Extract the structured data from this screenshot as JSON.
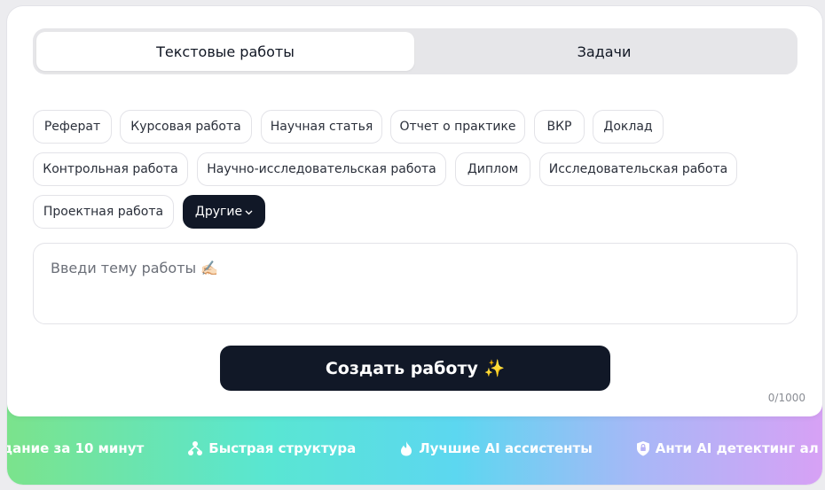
{
  "tabs": [
    {
      "label": "Текстовые работы",
      "active": true
    },
    {
      "label": "Задачи",
      "active": false
    }
  ],
  "chips": [
    {
      "label": "Реферат"
    },
    {
      "label": "Курсовая работа"
    },
    {
      "label": "Научная статья"
    },
    {
      "label": "Отчет о практике"
    },
    {
      "label": "ВКР"
    },
    {
      "label": "Доклад"
    },
    {
      "label": "Контрольная работа"
    },
    {
      "label": "Научно-исследовательская работа"
    },
    {
      "label": "Диплом"
    },
    {
      "label": "Исследовательская работа"
    },
    {
      "label": "Проектная работа"
    },
    {
      "label": "Другие",
      "selected": true,
      "icon": "chevron-down-icon"
    }
  ],
  "topic": {
    "placeholder": "Введи тему работы ✍🏻"
  },
  "create_button": {
    "label": "Создать работу ✨"
  },
  "counter": "0/1000",
  "features": [
    {
      "label": "дание за 10 минут",
      "icon": "none"
    },
    {
      "label": "Быстрая структура",
      "icon": "structure-icon"
    },
    {
      "label": "Лучшие AI ассистенты",
      "icon": "fire-icon"
    },
    {
      "label": "Анти AI детектинг ал",
      "icon": "shield-icon"
    }
  ],
  "colors": {
    "dark": "#111827",
    "tab_track": "#e6e6e9",
    "border": "#e3e3e8",
    "gradient": [
      "#7be38c",
      "#59e6d2",
      "#5cd7f0",
      "#a9b7f7",
      "#d7a1f5"
    ]
  }
}
